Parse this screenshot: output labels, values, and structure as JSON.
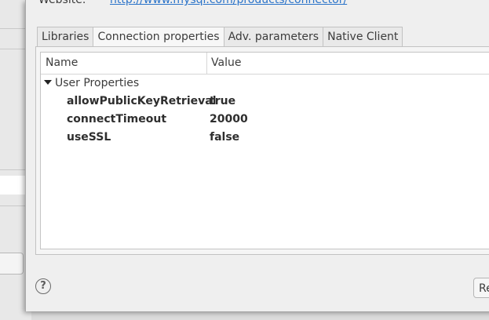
{
  "header": {
    "website_label": "Website:",
    "website_url": "http://www.mysql.com/products/connector/"
  },
  "tabs": [
    {
      "label": "Libraries",
      "active": false
    },
    {
      "label": "Connection properties",
      "active": true
    },
    {
      "label": "Adv. parameters",
      "active": false
    },
    {
      "label": "Native Client",
      "active": false
    }
  ],
  "table": {
    "columns": [
      "Name",
      "Value"
    ],
    "group": {
      "label": "User Properties",
      "expanded": true,
      "rows": [
        {
          "name": "allowPublicKeyRetrieval",
          "value": "true"
        },
        {
          "name": "connectTimeout",
          "value": "20000"
        },
        {
          "name": "useSSL",
          "value": "false"
        }
      ]
    }
  },
  "footer": {
    "help_symbol": "?",
    "right_button_label": "Re"
  },
  "colors": {
    "link": "#2a73c9",
    "dialog_bg": "#efefef",
    "table_bg": "#ffffff"
  },
  "icons": {
    "expand": "triangle-down-icon",
    "help": "question-circle-icon"
  }
}
